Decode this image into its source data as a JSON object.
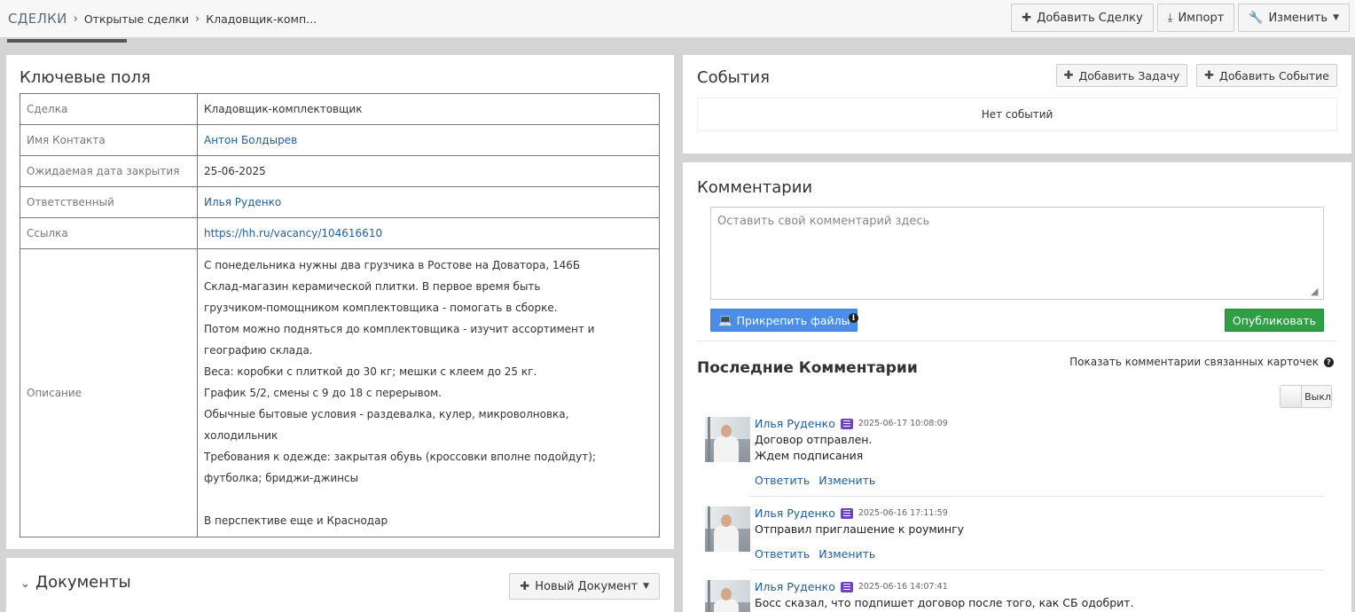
{
  "breadcrumb": {
    "root": "СДЕЛКИ",
    "items": [
      "Открытые сделки",
      "Кладовщик-комп..."
    ]
  },
  "toolbar": {
    "add_deal": "Добавить Сделку",
    "import": "Импорт",
    "edit": "Изменить"
  },
  "key_fields": {
    "title": "Ключевые поля",
    "rows": [
      {
        "label": "Сделка",
        "value": "Кладовщик-комплектовщик"
      },
      {
        "label": "Имя Контакта",
        "value": "Антон Болдырев"
      },
      {
        "label": "Ожидаемая дата закрытия",
        "value": "25-06-2025"
      },
      {
        "label": "Ответственный",
        "value": "Илья Руденко"
      },
      {
        "label": "Ссылка",
        "value": "https://hh.ru/vacancy/104616610"
      }
    ],
    "description_label": "Описание",
    "description_lines": [
      "С понедельника нужны два грузчика в Ростове на Доватора, 146Б",
      "Склад-магазин керамической плитки. В первое время быть",
      "грузчиком-помощником комплектовщика - помогать в сборке.",
      "Потом можно подняться до комплектовщика - изучит ассортимент и",
      "географию склада.",
      "Веса: коробки с плиткой до 30 кг; мешки с клеем до 25 кг.",
      "График 5/2, смены с 9 до 18 с перерывом.",
      "Обычные бытовые условия - раздевалка, кулер, микроволновка,",
      "холодильник",
      "Требования к одежде: закрытая обувь (кроссовки вполне подойдут);",
      "футболка; бриджи-джинсы",
      "",
      "В перспективе еще и Краснодар"
    ]
  },
  "documents": {
    "title": "Документы",
    "new_button": "Новый Документ"
  },
  "events": {
    "title": "События",
    "add_task": "Добавить Задачу",
    "add_event": "Добавить Событие",
    "empty": "Нет событий"
  },
  "comments": {
    "title": "Комментарии",
    "placeholder": "Оставить свой комментарий здесь",
    "attach": "Прикрепить файлы",
    "publish": "Опубликовать",
    "recent_title": "Последние Комментарии",
    "show_related": "Показать комментарии связанных карточек",
    "toggle_label": "Выкл",
    "reply": "Ответить",
    "edit": "Изменить",
    "items": [
      {
        "author": "Илья Руденко",
        "time": "2025-06-17 10:08:09",
        "line1": "Договор отправлен.",
        "line2": "Ждем подписания"
      },
      {
        "author": "Илья Руденко",
        "time": "2025-06-16 17:11:59",
        "line1": "Отправил приглашение к роумингу",
        "line2": ""
      },
      {
        "author": "Илья Руденко",
        "time": "2025-06-16 14:07:41",
        "line1": "Босс сказал, что подпишет договор после того, как СБ одобрит.",
        "line2": ""
      }
    ]
  },
  "colors": {
    "link": "#1f5e9e",
    "attach_button": "#4a8ee9",
    "publish_button": "#2ea043",
    "message_icon": "#6f42c1"
  }
}
